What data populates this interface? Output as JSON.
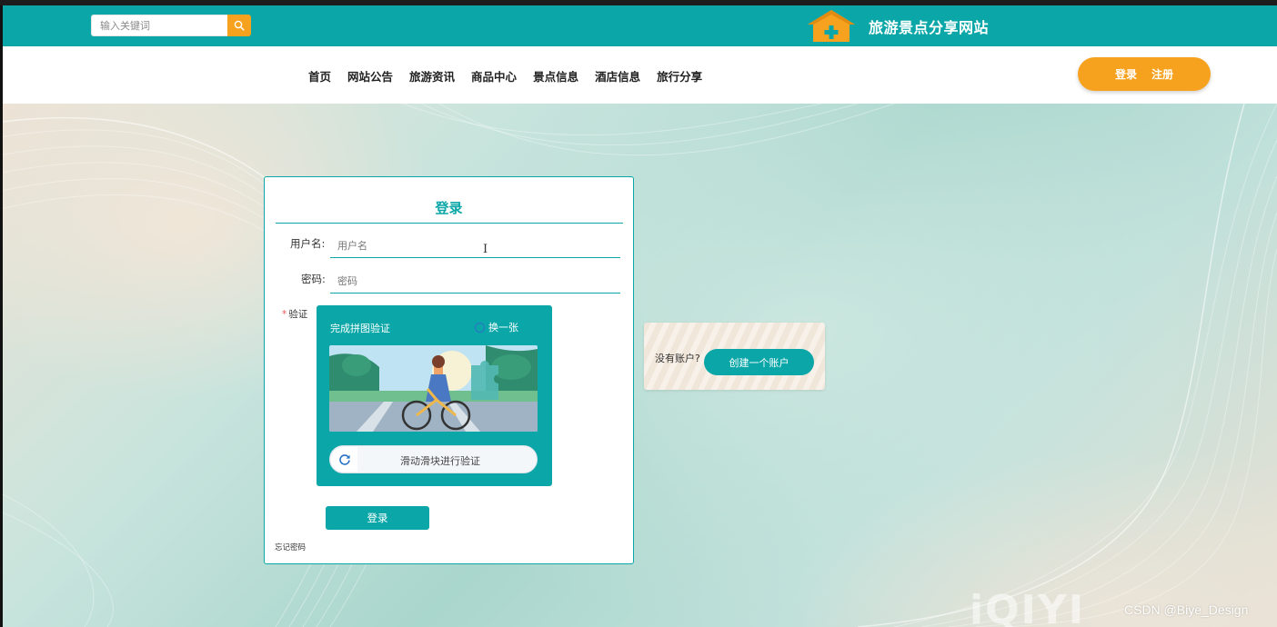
{
  "colors": {
    "teal": "#0ba7a8",
    "orange": "#f7a21e",
    "white": "#ffffff"
  },
  "header": {
    "search_placeholder": "输入关键词",
    "search_icon": "search-icon",
    "logo_icon": "house-plus-icon",
    "site_title": "旅游景点分享网站"
  },
  "nav": {
    "items": [
      "首页",
      "网站公告",
      "旅游资讯",
      "商品中心",
      "景点信息",
      "酒店信息",
      "旅行分享"
    ],
    "login_label": "登录",
    "register_label": "注册"
  },
  "login": {
    "title": "登录",
    "username_label": "用户名:",
    "username_placeholder": "用户名",
    "password_label": "密码:",
    "password_placeholder": "密码",
    "captcha_label": "验证",
    "captcha": {
      "title": "完成拼图验证",
      "refresh_label": "换一张",
      "slider_text": "滑动滑块进行验证",
      "slider_icon": "refresh-icon"
    },
    "submit_label": "登录",
    "forgot_label": "忘记密码"
  },
  "register": {
    "prompt": "没有账户?",
    "button_label": "创建一个账户"
  },
  "watermarks": {
    "player": "iQIYI",
    "author": "CSDN @Biye_Design"
  }
}
